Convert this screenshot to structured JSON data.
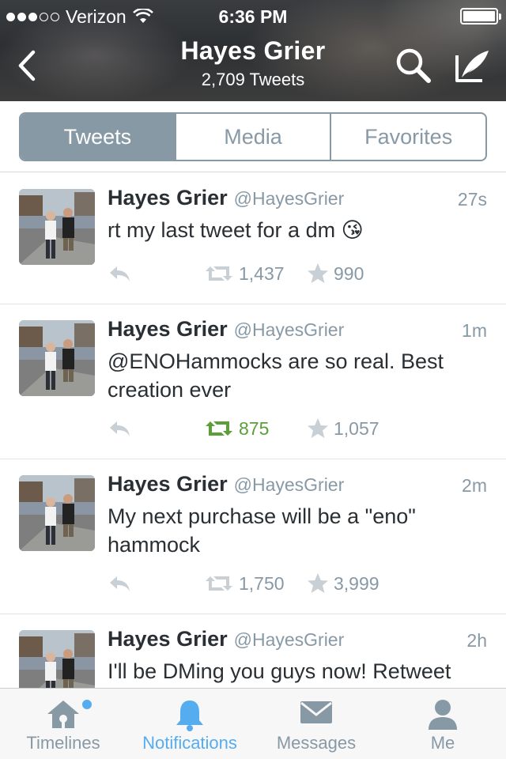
{
  "status_bar": {
    "carrier": "Verizon",
    "time": "6:36 PM",
    "signal_bars_filled": 3,
    "signal_bars_total": 5,
    "battery_level": 1.0
  },
  "header": {
    "name": "Hayes Grier",
    "tweet_count": "2,709 Tweets",
    "back_icon": "chevron-left-icon",
    "search_icon": "search-icon",
    "compose_icon": "compose-icon"
  },
  "segments": {
    "items": [
      {
        "label": "Tweets",
        "active": true
      },
      {
        "label": "Media",
        "active": false
      },
      {
        "label": "Favorites",
        "active": false
      }
    ]
  },
  "tweets": [
    {
      "name": "Hayes Grier",
      "handle": "@HayesGrier",
      "time": "27s",
      "text": "rt my last tweet for a dm 😘",
      "retweets": "1,437",
      "favorites": "990",
      "retweeted": false
    },
    {
      "name": "Hayes Grier",
      "handle": "@HayesGrier",
      "time": "1m",
      "text": "@ENOHammocks are so real. Best creation ever",
      "retweets": "875",
      "favorites": "1,057",
      "retweeted": true
    },
    {
      "name": "Hayes Grier",
      "handle": "@HayesGrier",
      "time": "2m",
      "text": "My next purchase will be a \"eno\" hammock",
      "retweets": "1,750",
      "favorites": "3,999",
      "retweeted": false
    },
    {
      "name": "Hayes Grier",
      "handle": "@HayesGrier",
      "time": "2h",
      "text": "I'll be DMing you guys now! Retweet",
      "retweets": "",
      "favorites": "",
      "retweeted": false
    }
  ],
  "tabbar": {
    "items": [
      {
        "label": "Timelines",
        "icon": "home-icon",
        "active": false,
        "badge": true
      },
      {
        "label": "Notifications",
        "icon": "bell-icon",
        "active": true,
        "badge": false
      },
      {
        "label": "Messages",
        "icon": "envelope-icon",
        "active": false,
        "badge": false
      },
      {
        "label": "Me",
        "icon": "person-icon",
        "active": false,
        "badge": false
      }
    ]
  },
  "colors": {
    "accent": "#55acee",
    "muted": "#8899a6",
    "text": "#292f33",
    "retweet_on": "#5c9e3a"
  }
}
